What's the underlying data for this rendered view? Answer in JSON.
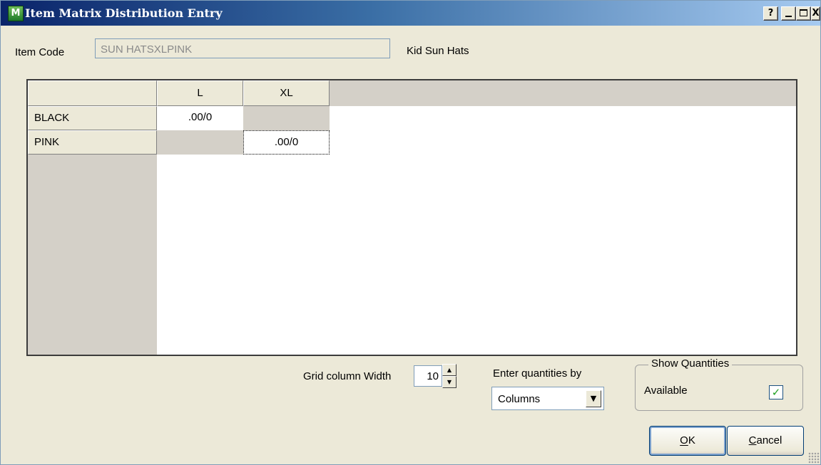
{
  "window": {
    "title": "Item Matrix Distribution Entry",
    "icon_text": "M",
    "buttons": {
      "help": "?",
      "close": "X"
    }
  },
  "item": {
    "code_label": "Item Code",
    "code_value": "SUN HATSXLPINK",
    "description": "Kid  Sun Hats"
  },
  "grid": {
    "columns": [
      "L",
      "XL"
    ],
    "rows": [
      {
        "label": "BLACK",
        "cells": [
          ".00/0",
          ""
        ]
      },
      {
        "label": "PINK",
        "cells": [
          "",
          ".00/0"
        ]
      }
    ]
  },
  "controls": {
    "grid_column_width_label": "Grid column Width",
    "grid_column_width_value": "10",
    "spin_up": "▲",
    "spin_down": "▼",
    "enter_by_label": "Enter quantities by",
    "enter_by_value": "Columns",
    "dropdown_arrow": "▼",
    "show_quantities_title": "Show Quantities",
    "available_label": "Available",
    "available_checked": true,
    "checkmark": "✓"
  },
  "buttons": {
    "ok": "OK",
    "cancel": "Cancel"
  },
  "colors": {
    "title_gradient_start": "#0a246a",
    "title_gradient_end": "#a6caf0",
    "face": "#ece9d8",
    "check_green": "#21a121"
  }
}
